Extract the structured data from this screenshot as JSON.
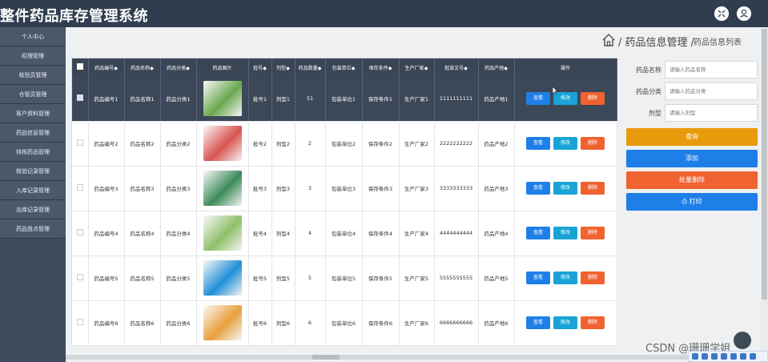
{
  "app": {
    "title": "整件药品库存管理系统"
  },
  "sidebar": {
    "items": [
      {
        "label": "个人中心"
      },
      {
        "label": "经理管理"
      },
      {
        "label": "核验员管理"
      },
      {
        "label": "仓管员管理"
      },
      {
        "label": "客户资料管理"
      },
      {
        "label": "药品信息管理"
      },
      {
        "label": "待核药品管理"
      },
      {
        "label": "核验记录管理"
      },
      {
        "label": "入库记录管理"
      },
      {
        "label": "出库记录管理"
      },
      {
        "label": "药品盘点管理"
      }
    ]
  },
  "breadcrumb": {
    "section": "/ 药品信息管理 /",
    "page": "药品信息列表"
  },
  "table": {
    "headers": [
      "药品编号",
      "药品名称",
      "药品分类",
      "药品图片",
      "批号",
      "剂型",
      "药品数量",
      "包装单位",
      "保存条件",
      "生产厂家",
      "批准文号",
      "药品产地",
      "操作"
    ],
    "sort_mark": "◆",
    "rows": [
      {
        "code": "药品编号1",
        "name": "药品名称1",
        "cat": "药品分类1",
        "batch": "批号1",
        "form": "剂型1",
        "qty": "51",
        "unit": "包装单位1",
        "storage": "保存条件1",
        "maker": "生产厂家1",
        "approval": "1111111111",
        "origin": "药品产地1",
        "pic_color": "#6aa84f",
        "selected": true
      },
      {
        "code": "药品编号2",
        "name": "药品名称2",
        "cat": "药品分类2",
        "batch": "批号2",
        "form": "剂型2",
        "qty": "2",
        "unit": "包装单位2",
        "storage": "保存条件2",
        "maker": "生产厂家2",
        "approval": "2222222222",
        "origin": "药品产地2",
        "pic_color": "#d9534f",
        "selected": false
      },
      {
        "code": "药品编号3",
        "name": "药品名称3",
        "cat": "药品分类3",
        "batch": "批号3",
        "form": "剂型3",
        "qty": "3",
        "unit": "包装单位3",
        "storage": "保存条件3",
        "maker": "生产厂家3",
        "approval": "3333333333",
        "origin": "药品产地3",
        "pic_color": "#3d8b5a",
        "selected": false
      },
      {
        "code": "药品编号4",
        "name": "药品名称4",
        "cat": "药品分类4",
        "batch": "批号4",
        "form": "剂型4",
        "qty": "4",
        "unit": "包装单位4",
        "storage": "保存条件4",
        "maker": "生产厂家4",
        "approval": "4444444444",
        "origin": "药品产地4",
        "pic_color": "#8fbf6a",
        "selected": false
      },
      {
        "code": "药品编号5",
        "name": "药品名称5",
        "cat": "药品分类5",
        "batch": "批号5",
        "form": "剂型5",
        "qty": "5",
        "unit": "包装单位5",
        "storage": "保存条件5",
        "maker": "生产厂家5",
        "approval": "5555555555",
        "origin": "药品产地5",
        "pic_color": "#1f8fd6",
        "selected": false
      },
      {
        "code": "药品编号6",
        "name": "药品名称6",
        "cat": "药品分类6",
        "batch": "批号6",
        "form": "剂型6",
        "qty": "6",
        "unit": "包装单位6",
        "storage": "保存条件6",
        "maker": "生产厂家6",
        "approval": "6666666666",
        "origin": "药品产地6",
        "pic_color": "#e8a03c",
        "selected": false
      }
    ],
    "actions": {
      "view": "查看",
      "edit": "修改",
      "delete": "删除"
    }
  },
  "search": {
    "name_label": "药品名称",
    "name_placeholder": "请输入药品名称",
    "cat_label": "药品分类",
    "cat_placeholder": "请输入药品分类",
    "form_label": "剂型",
    "form_placeholder": "请输入剂型",
    "query": "查询",
    "add": "添加",
    "batch_delete": "批量删除",
    "print": "打印"
  },
  "colors": {
    "header": "#2f3d4f",
    "query": "#e89a0c",
    "add": "#1f7fe8",
    "delete": "#f0622f",
    "print": "#1f7fe8"
  },
  "watermark": "CSDN @珊珊学姐"
}
